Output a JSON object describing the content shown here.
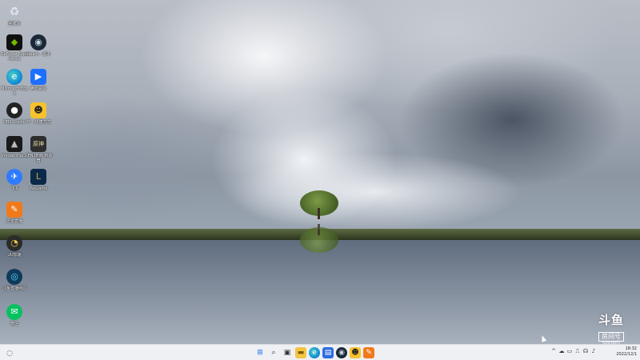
{
  "desktop": {
    "icons": [
      {
        "name": "recycle-bin",
        "label": "回收站",
        "glyph": "♻"
      },
      {
        "name": "geforce-experience",
        "label": "GeForce Experience",
        "glyph": "◆"
      },
      {
        "name": "steam",
        "label": "steam - 副本",
        "glyph": "◉"
      },
      {
        "name": "microsoft-edge",
        "label": "Microsoft Edge",
        "glyph": "e"
      },
      {
        "name": "tencent-meeting",
        "label": "腾讯会议",
        "glyph": "▶"
      },
      {
        "name": "obs-studio",
        "label": "OBS Studio",
        "glyph": "●"
      },
      {
        "name": "yy-voice",
        "label": "YY - 快捷方式",
        "glyph": "☻"
      },
      {
        "name": "predator-sense",
        "label": "PredatorSe...",
        "glyph": "▲"
      },
      {
        "name": "genshin-launcher",
        "label": "GENSHIN 启动器",
        "glyph": "原神"
      },
      {
        "name": "feishu",
        "label": "飞书",
        "glyph": "✈"
      },
      {
        "name": "league-of-legends",
        "label": "WeGame",
        "glyph": "L"
      },
      {
        "name": "orange-app",
        "label": "迅雷直播",
        "glyph": "✎"
      },
      {
        "name": "speedtest",
        "label": "UU加速",
        "glyph": "◔"
      },
      {
        "name": "video-app",
        "label": "斗鱼直播伴侣",
        "glyph": "◎"
      },
      {
        "name": "wechat",
        "label": "微信",
        "glyph": "✉"
      }
    ]
  },
  "watermark": {
    "brand": "斗鱼",
    "room": "房间号",
    "id": "5097602"
  },
  "taskbar": {
    "left_icon": "◌",
    "items": [
      {
        "name": "start-button",
        "glyph": "⊞"
      },
      {
        "name": "search-button",
        "glyph": "⌕"
      },
      {
        "name": "task-view-button",
        "glyph": "▣"
      },
      {
        "name": "file-explorer-button",
        "glyph": "▬"
      },
      {
        "name": "edge-button",
        "glyph": "e"
      },
      {
        "name": "store-button",
        "glyph": "▤"
      },
      {
        "name": "steam-button",
        "glyph": "◉"
      },
      {
        "name": "yy-button",
        "glyph": "☻"
      },
      {
        "name": "orange-app-button",
        "glyph": "✎"
      }
    ],
    "tray": [
      "^",
      "☁",
      "▭",
      "⎍",
      "☊",
      "♪"
    ],
    "time": "18:32",
    "date": "2022/12/1"
  },
  "colors": {
    "taskbar_bg": "#eef0f3",
    "accent": "#1a73e8"
  }
}
